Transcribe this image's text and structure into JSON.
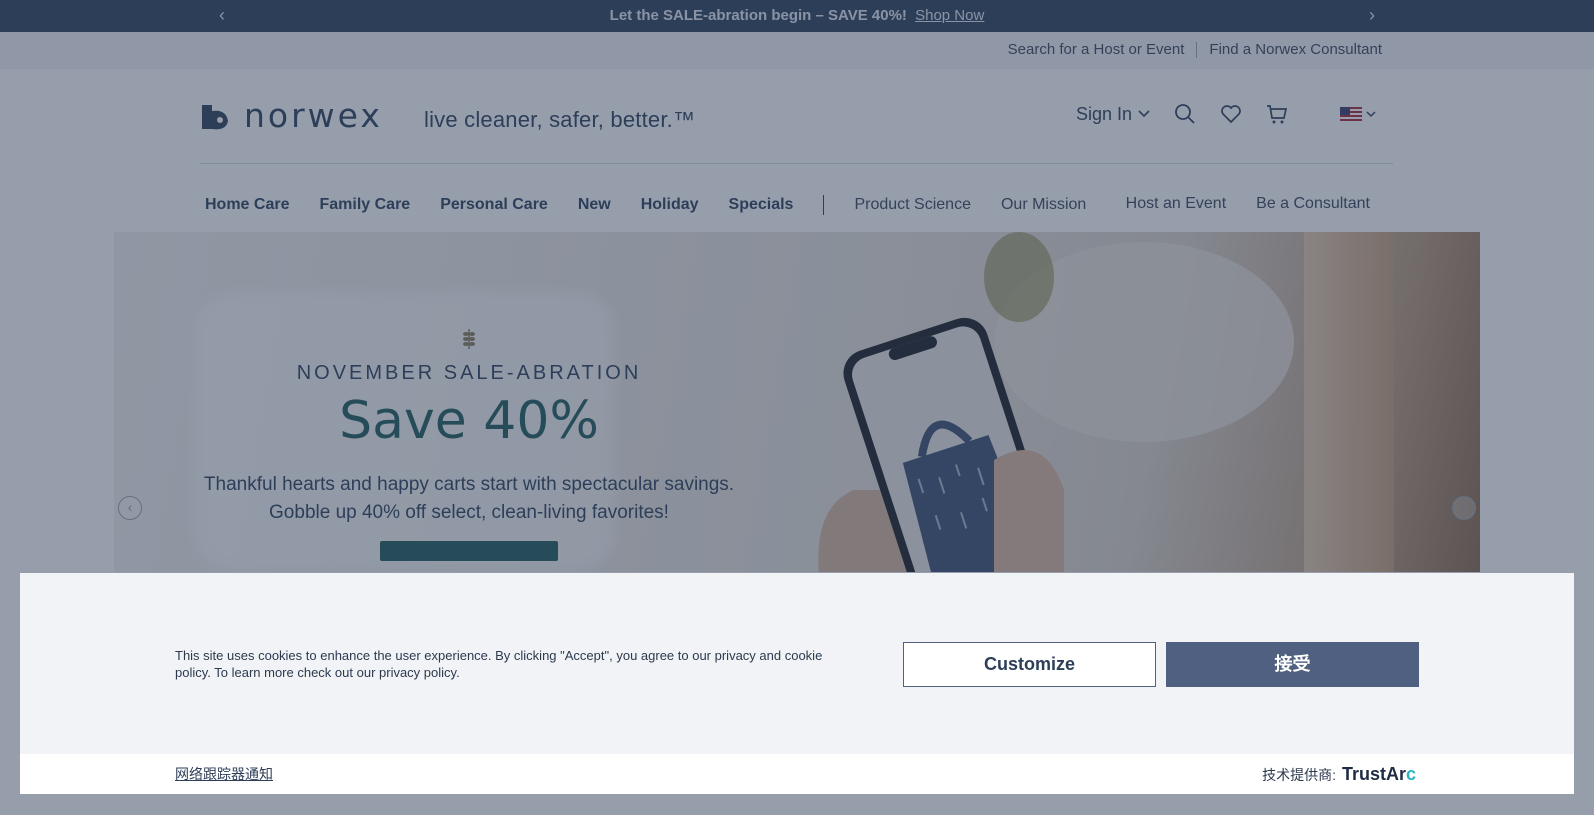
{
  "promo": {
    "text": "Let the SALE-abration begin – SAVE 40%!",
    "link": "Shop Now",
    "prev_icon": "chevron-left-icon",
    "next_icon": "chevron-right-icon"
  },
  "utility": {
    "search_host": "Search for a Host or Event",
    "find_consultant": "Find a Norwex Consultant"
  },
  "header": {
    "logo_text": "norwex",
    "tagline": "live cleaner, safer, better.™",
    "signin": "Sign In",
    "icons": [
      "search-icon",
      "heart-icon",
      "cart-icon",
      "us-flag-icon"
    ]
  },
  "nav": {
    "primary": [
      "Home Care",
      "Family Care",
      "Personal Care",
      "New",
      "Holiday",
      "Specials"
    ],
    "secondary": [
      "Product Science",
      "Our Mission"
    ],
    "right": [
      "Host an Event",
      "Be a Consultant"
    ]
  },
  "hero": {
    "eyebrow": "NOVEMBER SALE-ABRATION",
    "headline": "Save 40%",
    "line1": "Thankful hearts and happy carts start with spectacular savings.",
    "line2": "Gobble up 40% off select, clean-living favorites!"
  },
  "cookie": {
    "text": "This site uses cookies to enhance the user experience. By clicking \"Accept\", you agree to our privacy and cookie policy. To learn more check out our privacy policy.",
    "customize": "Customize",
    "accept": "接受",
    "tracker_notice": "网络跟踪器通知",
    "powered_by": "技术提供商:",
    "brand_main": "TrustAr",
    "brand_end": "c"
  },
  "colors": {
    "navy": "#2d3e59",
    "teal": "#1d5a56",
    "accept_button": "#4f6080",
    "trustarc_accent": "#2bb5c3"
  }
}
